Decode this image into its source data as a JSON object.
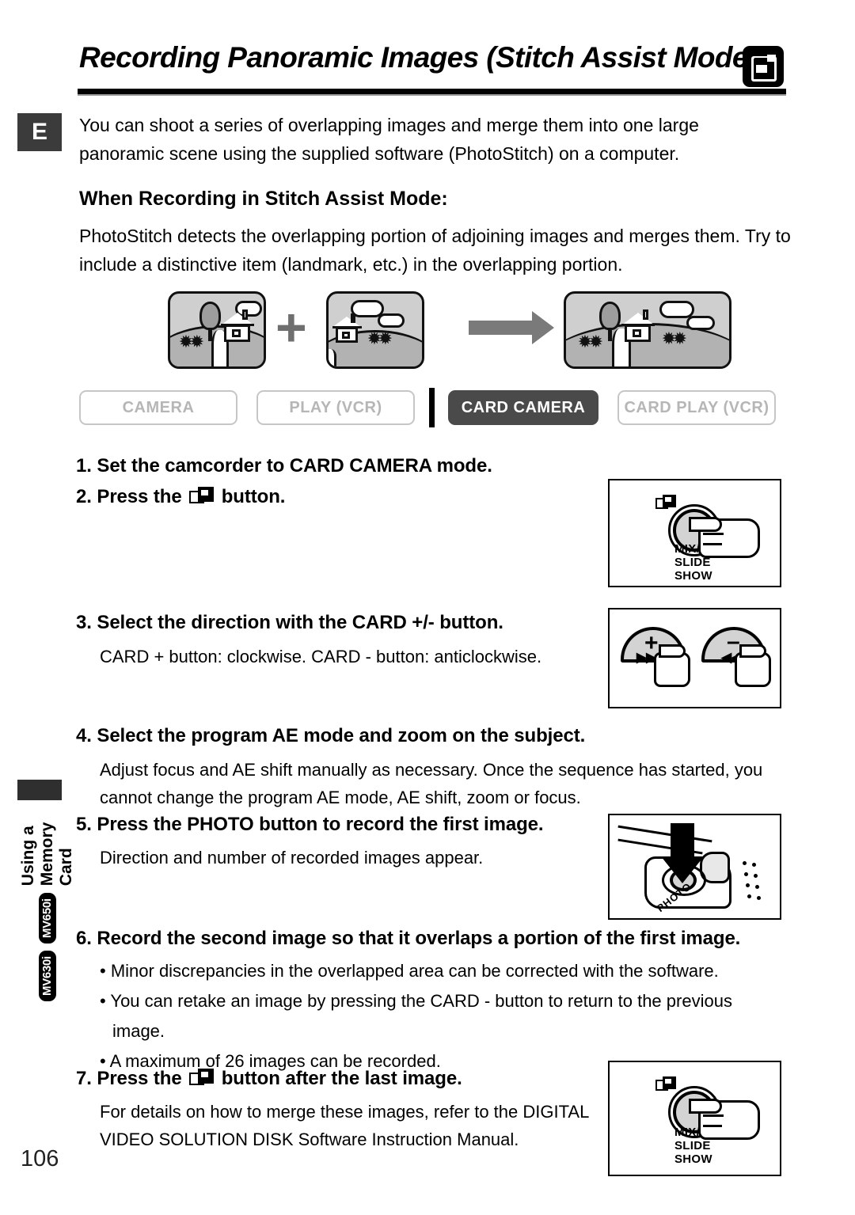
{
  "header": {
    "title": "Recording Panoramic Images (Stitch Assist Mode)",
    "card_icon": "memory-card-icon"
  },
  "edge": {
    "language_marker": "E",
    "side_tab_text": "Using a Memory Card",
    "side_tab_badges": [
      "MV650i",
      "MV630i"
    ]
  },
  "intro": {
    "paragraph": "You can shoot a series of overlapping images and merge them into one large panoramic scene using the supplied software (PhotoStitch) on a computer."
  },
  "section": {
    "subhead": "When Recording in Stitch Assist Mode:",
    "body": "PhotoStitch detects the overlapping portion of adjoining images and merges them. Try to include a distinctive item (landmark, etc.) in the overlapping portion."
  },
  "diagram": {
    "plus_symbol": "+",
    "arrow": "merge-arrow",
    "image_a_alt": "landscape-with-tree-and-house",
    "image_b_alt": "landscape-with-house-and-clouds",
    "image_result_alt": "merged-panoramic-landscape"
  },
  "modes": {
    "items": [
      {
        "label": "CAMERA",
        "active": false
      },
      {
        "label": "PLAY (VCR)",
        "active": false
      },
      {
        "label": "CARD CAMERA",
        "active": true
      },
      {
        "label": "CARD PLAY (VCR)",
        "active": false
      }
    ]
  },
  "steps": [
    {
      "number": "1.",
      "heading": "Set the camcorder to CARD CAMERA mode."
    },
    {
      "number": "2.",
      "heading_before": "Press the",
      "heading_after": "button.",
      "icon": "stitch-assist-icon"
    },
    {
      "number": "3.",
      "heading": "Select the direction with the CARD +/- button.",
      "body": "CARD + button: clockwise. CARD - button: anticlockwise."
    },
    {
      "number": "4.",
      "heading": "Select the program AE mode and zoom on the subject.",
      "body": "Adjust focus and AE shift manually as necessary. Once the sequence has started, you cannot change the program AE mode, AE shift, zoom or focus."
    },
    {
      "number": "5.",
      "heading": "Press the PHOTO button to record the first image.",
      "body": "Direction and number of recorded images appear."
    },
    {
      "number": "6.",
      "heading": "Record the second image so that it overlaps a portion of the first image.",
      "bullets": [
        "• Minor discrepancies in the overlapped area can be corrected with the software.",
        "• You can retake an image by pressing the CARD - button to return to the previous image.",
        "• A maximum of 26 images can be recorded."
      ]
    },
    {
      "number": "7.",
      "heading_before": "Press the",
      "heading_after": "button after the last image.",
      "icon": "stitch-assist-icon",
      "body": "For details on how to merge these images, refer to the DIGITAL VIDEO SOLUTION DISK Software Instruction Manual."
    }
  ],
  "figures": {
    "mix_slide_show": {
      "label_line1": "MIX/",
      "label_line2": "SLIDE",
      "label_line3": "SHOW",
      "icon": "stitch-assist-icon",
      "alt": "finger-pressing-mix-slide-show-button"
    },
    "card_plus_minus": {
      "plus_symbol": "+",
      "minus_symbol": "–",
      "plus_sub": "▶▶",
      "minus_sub": "◀◀",
      "alt": "fingers-pressing-card-plus-and-minus-buttons"
    },
    "photo_button": {
      "label": "PHOTO",
      "alt": "arrow-pressing-photo-button-on-camcorder"
    }
  },
  "footer": {
    "page_number": "106"
  },
  "colors": {
    "active_mode_bg": "#4a4a4a",
    "inactive_mode_text": "#b6b6b6",
    "edge_marker_bg": "#3b3b3b",
    "illustration_gray": "#cfcfcf",
    "arrow_gray": "#7a7a7a"
  }
}
